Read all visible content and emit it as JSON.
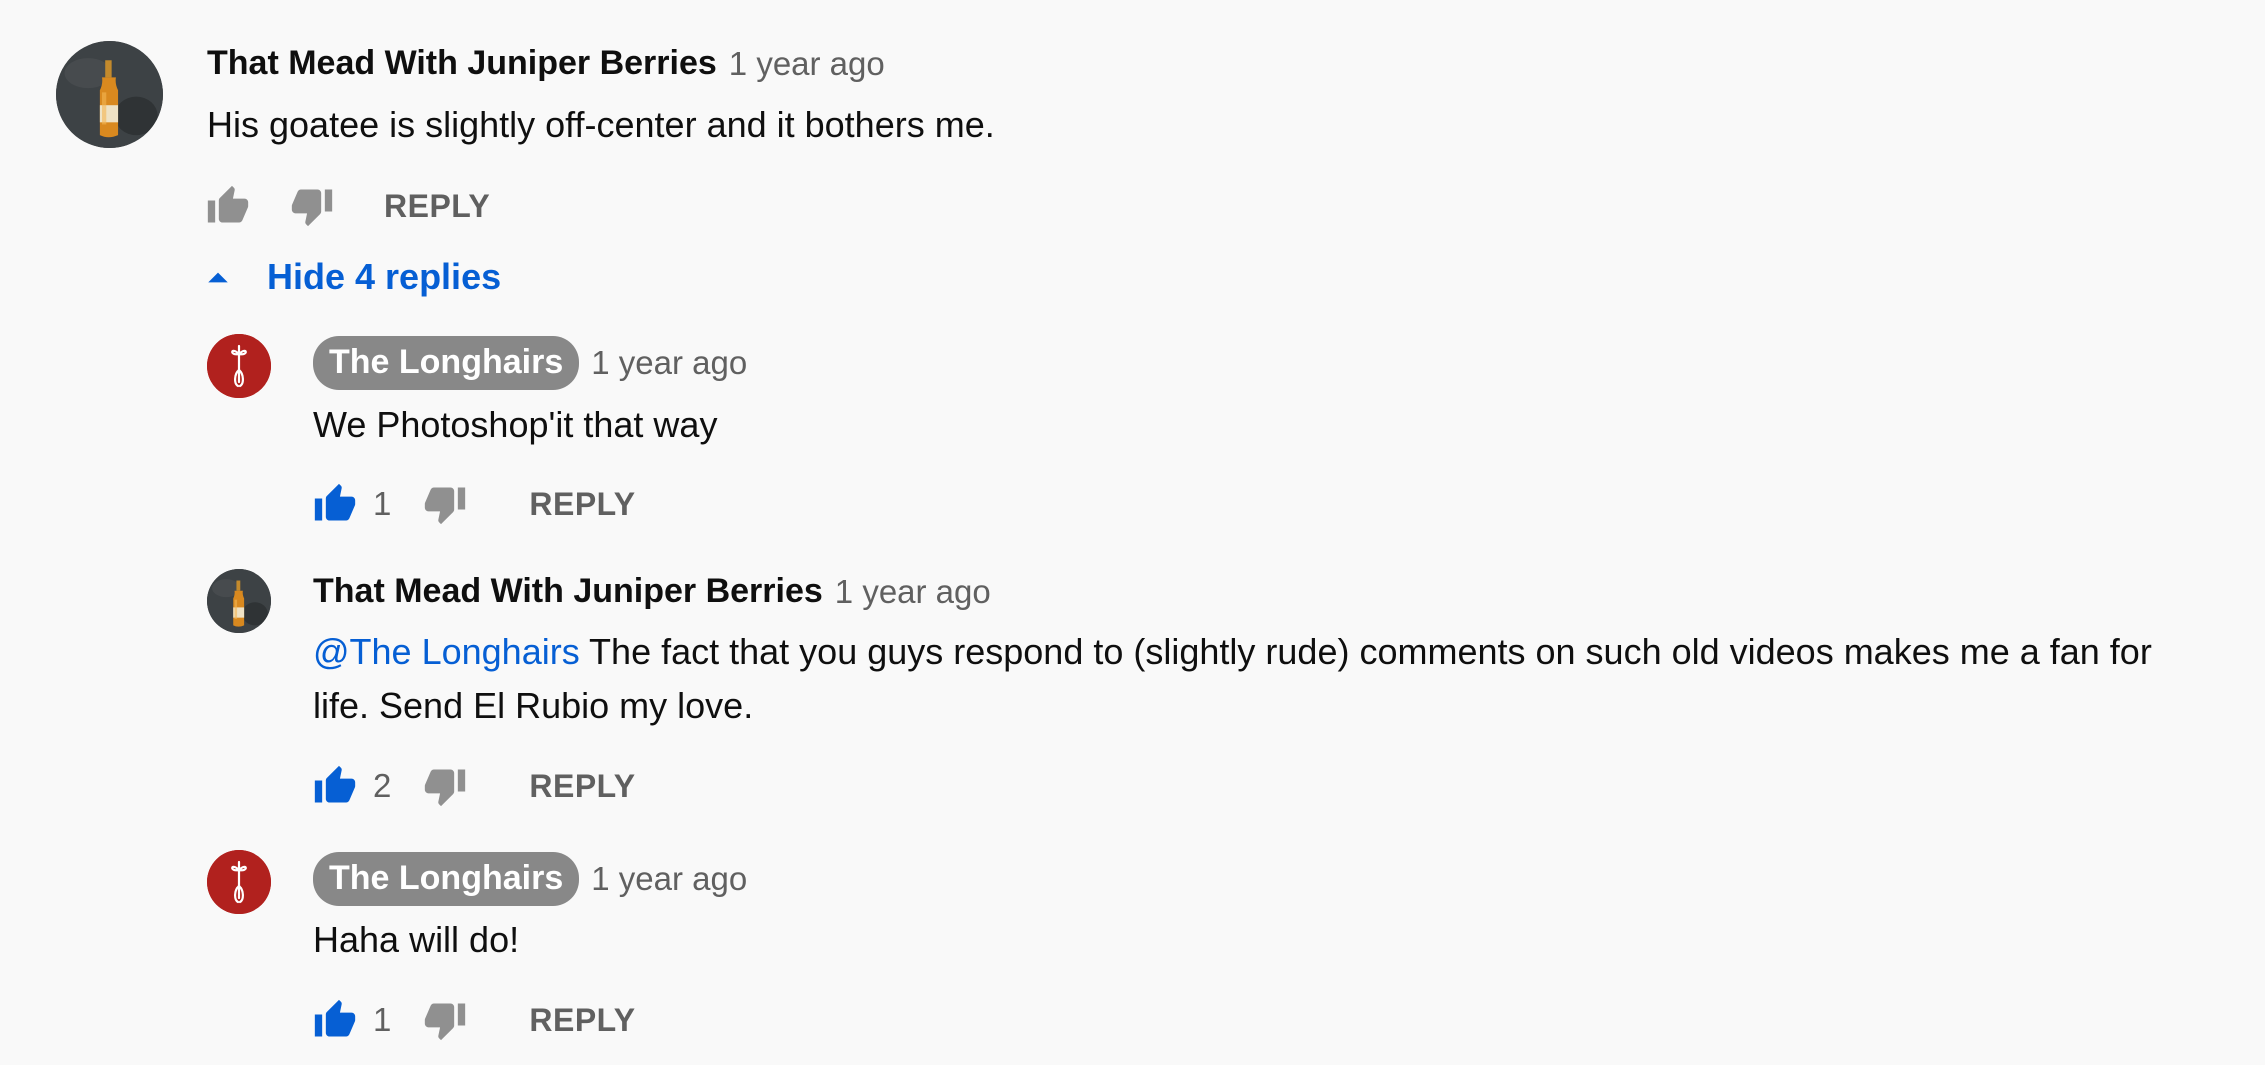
{
  "top_comment": {
    "author": "That Mead With Juniper Berries",
    "time": "1 year ago",
    "text": "His goatee is slightly off-center and it bothers me.",
    "reply_label": "REPLY"
  },
  "toggle": {
    "label": "Hide 4 replies"
  },
  "replies": [
    {
      "author": "The Longhairs",
      "owner": true,
      "time": "1 year ago",
      "text": "We Photoshop'it that way",
      "likes": "1",
      "liked": true,
      "reply_label": "REPLY"
    },
    {
      "author": "That Mead With Juniper Berries",
      "owner": false,
      "time": "1 year ago",
      "mention": "@The Longhairs",
      "text_line1": " The fact that you guys respond to (slightly rude) comments on such old videos makes me a fan for",
      "text_line2": "life. Send El Rubio my love.",
      "likes": "2",
      "liked": true,
      "reply_label": "REPLY"
    },
    {
      "author": "The Longhairs",
      "owner": true,
      "time": "1 year ago",
      "text": "Haha will do!",
      "likes": "1",
      "liked": true,
      "reply_label": "REPLY"
    }
  ],
  "icons": {
    "like": "thumbs-up-icon",
    "dislike": "thumbs-down-icon",
    "collapse": "caret-up-icon"
  },
  "colors": {
    "background": "#f9f9f9",
    "link_blue": "#065fd4",
    "liked_blue": "#065fd4",
    "icon_gray": "#909090",
    "owner_chip": "#888888",
    "longhairs_avatar": "#b1211e"
  }
}
